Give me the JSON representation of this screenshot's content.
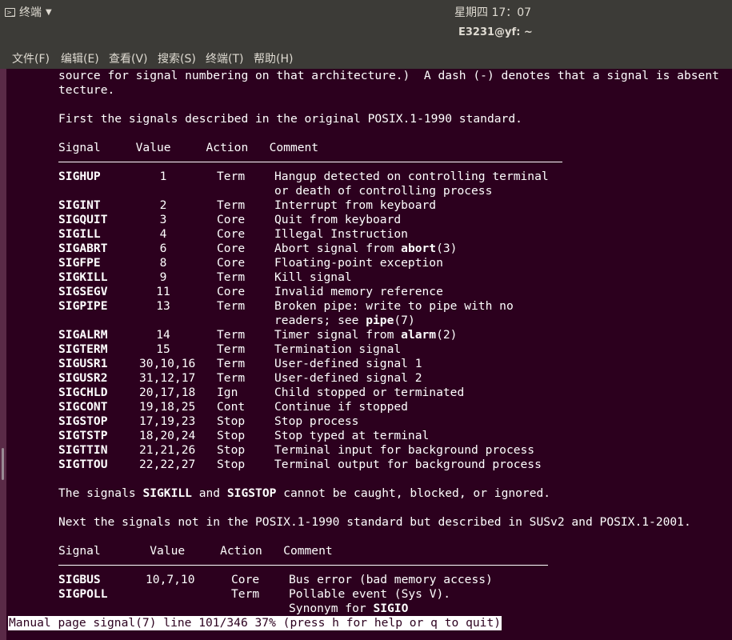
{
  "topbar": {
    "app_name": "终端",
    "clock": "星期四 17：07"
  },
  "window": {
    "title": "E3231@yf: ~"
  },
  "menu": [
    "文件(F)",
    "编辑(E)",
    "查看(V)",
    "搜索(S)",
    "终端(T)",
    "帮助(H)"
  ],
  "content": {
    "intro_line1": "source for signal numbering on that architecture.)  A dash (-) denotes that a signal is absent",
    "intro_line2": "tecture.",
    "posix1990_heading": "First the signals described in the original POSIX.1-1990 standard.",
    "table1_header": "Signal     Value     Action   Comment",
    "table1_rows": [
      {
        "sig": "SIGHUP",
        "value": "1",
        "action": "Term",
        "comment": "Hangup detected on controlling terminal"
      },
      {
        "sig": "",
        "value": "",
        "action": "",
        "comment": "or death of controlling process"
      },
      {
        "sig": "SIGINT",
        "value": "2",
        "action": "Term",
        "comment": "Interrupt from keyboard"
      },
      {
        "sig": "SIGQUIT",
        "value": "3",
        "action": "Core",
        "comment": "Quit from keyboard"
      },
      {
        "sig": "SIGILL",
        "value": "4",
        "action": "Core",
        "comment": "Illegal Instruction"
      },
      {
        "sig": "SIGABRT",
        "value": "6",
        "action": "Core",
        "comment": "Abort signal from |abort|(3)"
      },
      {
        "sig": "SIGFPE",
        "value": "8",
        "action": "Core",
        "comment": "Floating-point exception"
      },
      {
        "sig": "SIGKILL",
        "value": "9",
        "action": "Term",
        "comment": "Kill signal"
      },
      {
        "sig": "SIGSEGV",
        "value": "11",
        "action": "Core",
        "comment": "Invalid memory reference"
      },
      {
        "sig": "SIGPIPE",
        "value": "13",
        "action": "Term",
        "comment": "Broken pipe: write to pipe with no"
      },
      {
        "sig": "",
        "value": "",
        "action": "",
        "comment": "readers; see |pipe|(7)"
      },
      {
        "sig": "SIGALRM",
        "value": "14",
        "action": "Term",
        "comment": "Timer signal from |alarm|(2)"
      },
      {
        "sig": "SIGTERM",
        "value": "15",
        "action": "Term",
        "comment": "Termination signal"
      },
      {
        "sig": "SIGUSR1",
        "value": "30,10,16",
        "action": "Term",
        "comment": "User-defined signal 1"
      },
      {
        "sig": "SIGUSR2",
        "value": "31,12,17",
        "action": "Term",
        "comment": "User-defined signal 2"
      },
      {
        "sig": "SIGCHLD",
        "value": "20,17,18",
        "action": "Ign",
        "comment": "Child stopped or terminated"
      },
      {
        "sig": "SIGCONT",
        "value": "19,18,25",
        "action": "Cont",
        "comment": "Continue if stopped"
      },
      {
        "sig": "SIGSTOP",
        "value": "17,19,23",
        "action": "Stop",
        "comment": "Stop process"
      },
      {
        "sig": "SIGTSTP",
        "value": "18,20,24",
        "action": "Stop",
        "comment": "Stop typed at terminal"
      },
      {
        "sig": "SIGTTIN",
        "value": "21,21,26",
        "action": "Stop",
        "comment": "Terminal input for background process"
      },
      {
        "sig": "SIGTTOU",
        "value": "22,22,27",
        "action": "Stop",
        "comment": "Terminal output for background process"
      }
    ],
    "note_line": "The signals |SIGKILL| and |SIGSTOP| cannot be caught, blocked, or ignored.",
    "susv2_heading": "Next the signals not in the POSIX.1-1990 standard but described in SUSv2 and POSIX.1-2001.",
    "table2_header": "Signal       Value     Action   Comment",
    "table2_rows": [
      {
        "sig": "SIGBUS",
        "value": "10,7,10",
        "action": "Core",
        "comment": "Bus error (bad memory access)"
      },
      {
        "sig": "SIGPOLL",
        "value": "",
        "action": "Term",
        "comment": "Pollable event (Sys V)."
      },
      {
        "sig": "",
        "value": "",
        "action": "",
        "comment": "Synonym for |SIGIO|"
      }
    ]
  },
  "status_line": "Manual page signal(7) line 101/346 37% (press h for help or q to quit)"
}
